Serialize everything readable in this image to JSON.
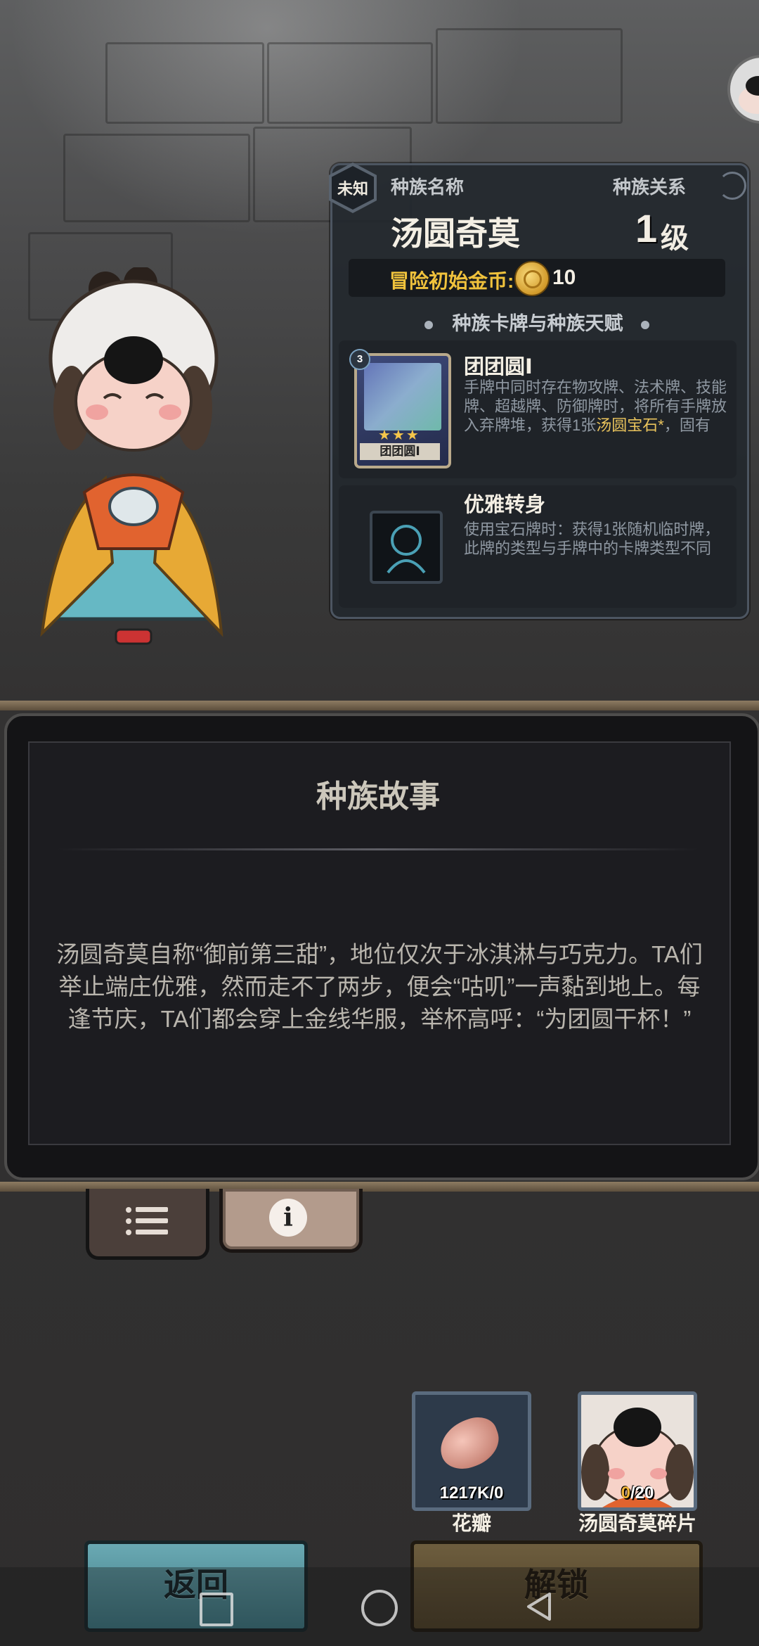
{
  "race_panel": {
    "status_badge": "未知",
    "race_name_label": "种族名称",
    "relation_label": "种族关系",
    "race_name": "汤圆奇莫",
    "level_value": "1",
    "level_unit": "级",
    "gold_label": "冒险初始金币:",
    "gold_value": "10",
    "section_title": "种族卡牌与种族天赋",
    "card": {
      "badge": "3",
      "name": "团团圆Ⅰ",
      "title": "团团圆Ⅰ",
      "desc_main": "手牌中同时存在物攻牌、法术牌、技能牌、超越牌、防御牌时，将所有手牌放入弃牌堆，获得1张",
      "desc_highlight": "汤圆宝石*",
      "desc_tail": "，固有",
      "stars": "★★★"
    },
    "talent": {
      "title": "优雅转身",
      "desc": "使用宝石牌时：获得1张随机临时牌，此牌的类型与手牌中的卡牌类型不同"
    }
  },
  "story": {
    "title": "种族故事",
    "text": "汤圆奇莫自称“御前第三甜”，地位仅次于冰淇淋与巧克力。TA们举止端庄优雅，然而走不了两步，便会“咕叽”一声黏到地上。每逢节庆，TA们都会穿上金线华服，举杯高呼：“为团圆干杯！”"
  },
  "tabs": {
    "info_glyph": "i"
  },
  "resources": [
    {
      "name": "花瓣",
      "count": "1217K/0"
    },
    {
      "name": "汤圆奇莫碎片",
      "count_have": "0",
      "count_total": "/20"
    }
  ],
  "buttons": {
    "back": "返回",
    "unlock": "解锁"
  },
  "icons": [
    "list-icon",
    "info-icon",
    "coin-icon",
    "swirl-icon",
    "petal-icon",
    "nav-square-icon",
    "nav-home-icon",
    "nav-back-icon"
  ],
  "colors": {
    "gold_text": "#f0c23c",
    "highlight_text": "#e9c35c",
    "back_button": "#4f8e98",
    "unlock_button": "#5e4f33"
  }
}
